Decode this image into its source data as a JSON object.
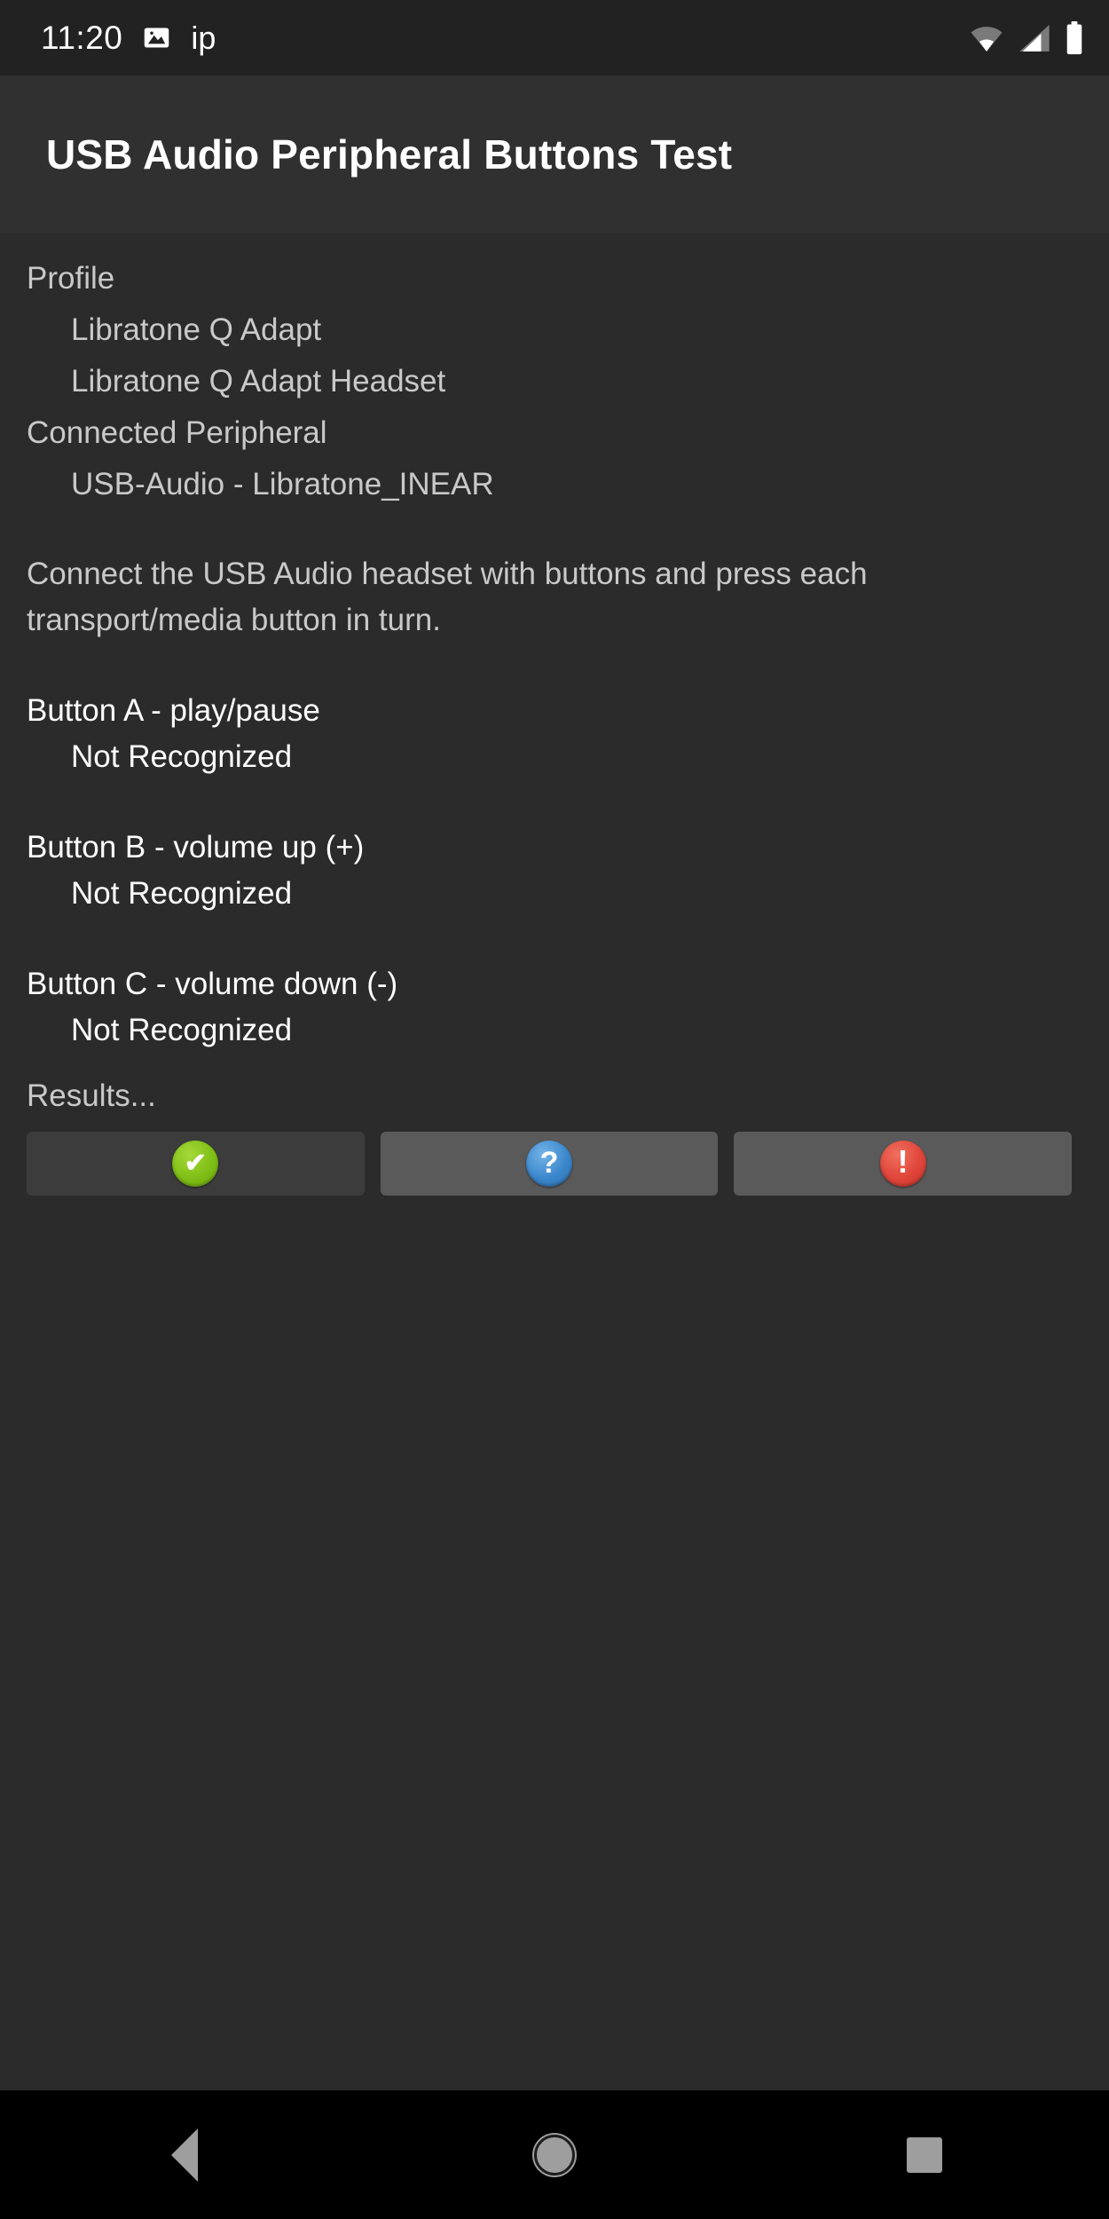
{
  "status_bar": {
    "clock": "11:20",
    "notification_text": "ip",
    "notification_icon": "image-icon",
    "wifi_icon": "wifi-icon",
    "signal_icon": "cell-signal-icon",
    "battery_icon": "battery-full-icon"
  },
  "header": {
    "title": "USB Audio Peripheral Buttons Test"
  },
  "info": {
    "profile_label": "Profile",
    "profile_values": [
      "Libratone Q Adapt",
      "Libratone Q Adapt Headset"
    ],
    "peripheral_label": "Connected Peripheral",
    "peripheral_value": "USB-Audio - Libratone_INEAR"
  },
  "instructions": "Connect the USB Audio headset with buttons and press each transport/media button in turn.",
  "button_tests": [
    {
      "label": "Button A - play/pause",
      "status": "Not Recognized"
    },
    {
      "label": "Button B - volume up (+)",
      "status": "Not Recognized"
    },
    {
      "label": "Button C - volume down (-)",
      "status": "Not Recognized"
    }
  ],
  "results": {
    "label": "Results...",
    "buttons": [
      {
        "name": "pass-button",
        "icon": "check-circle-icon",
        "glyph": "✔",
        "color": "#8cc51a",
        "enabled": false
      },
      {
        "name": "info-button",
        "icon": "question-circle-icon",
        "glyph": "?",
        "color": "#3b87cc",
        "enabled": true
      },
      {
        "name": "fail-button",
        "icon": "exclamation-circle-icon",
        "glyph": "!",
        "color": "#e0453a",
        "enabled": true
      }
    ]
  },
  "nav_bar": {
    "back_label": "Back",
    "home_label": "Home",
    "recents_label": "Recents"
  }
}
